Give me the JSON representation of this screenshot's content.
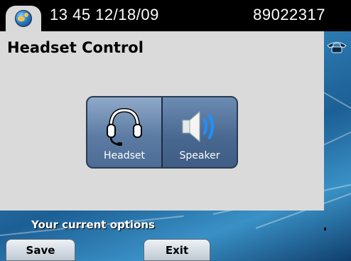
{
  "header": {
    "timestamp": "13 45 12/18/09",
    "extension": "89022317",
    "tab_icon": "globe-icon"
  },
  "page": {
    "title": "Headset Control",
    "line_icon": "phone-line-icon"
  },
  "audio_modes": [
    {
      "label": "Headset",
      "icon": "headset-icon"
    },
    {
      "label": "Speaker",
      "icon": "speaker-icon"
    }
  ],
  "status": {
    "text": "Your current options"
  },
  "softkeys": {
    "save": "Save",
    "exit": "Exit"
  },
  "colors": {
    "panel": "#dadada",
    "topbar": "#000000",
    "button_face": "#5d7ca4",
    "speaker_waves": "#1e90ff"
  }
}
